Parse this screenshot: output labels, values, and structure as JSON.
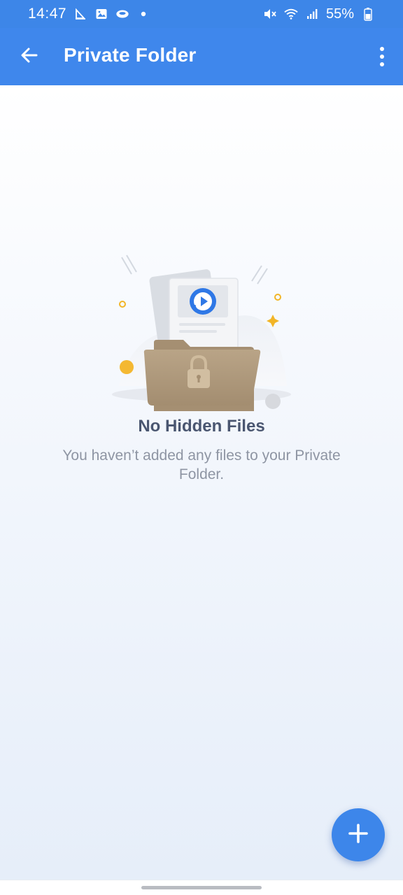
{
  "status_bar": {
    "time": "14:47",
    "left_icons": [
      "sailing-icon",
      "image-icon",
      "cloud-icon",
      "dot-icon"
    ],
    "right_icons": [
      "mute-icon",
      "wifi-icon",
      "signal-icon",
      "battery-icon"
    ],
    "battery": "55%"
  },
  "app_bar": {
    "title": "Private Folder",
    "back_icon": "arrow-left-icon",
    "menu_icon": "more-vertical-icon"
  },
  "empty_state": {
    "title": "No Hidden Files",
    "description": "You haven’t added any files to your Private Folder.",
    "illustration": "locked-folder-illustration"
  },
  "fab": {
    "icon": "plus-icon"
  },
  "colors": {
    "primary": "#3f87ec",
    "title_text": "#4a5670",
    "desc_text": "#8e95a3"
  }
}
